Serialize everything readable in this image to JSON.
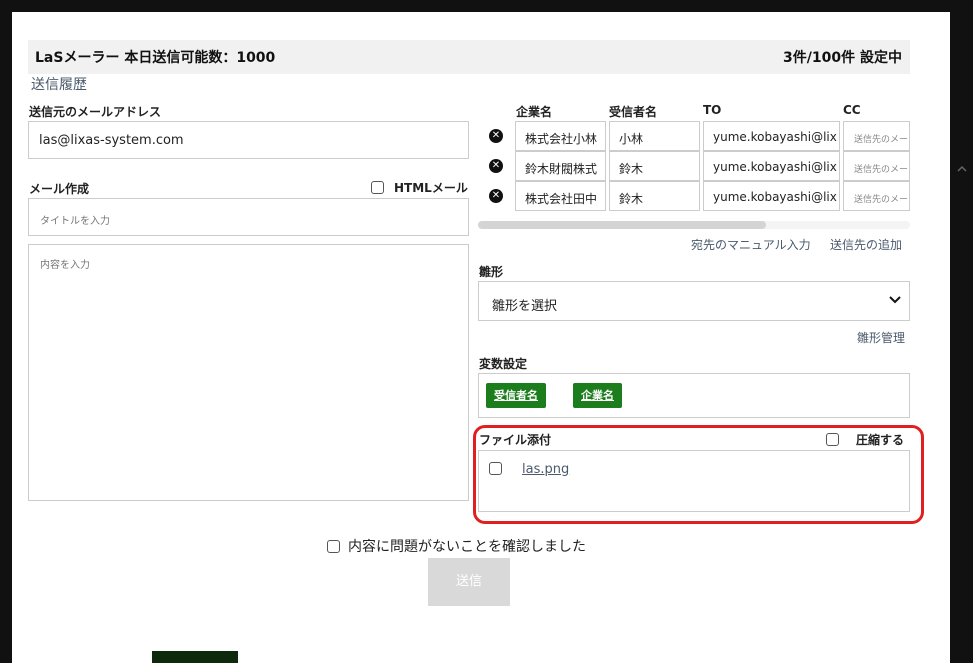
{
  "header": {
    "app_title": "LaSメーラー  本日送信可能数：1000",
    "count_status": "3件/100件 設定中"
  },
  "history_link": "送信履歴",
  "sender": {
    "label": "送信元のメールアドレス",
    "value": "las@lixas-system.com"
  },
  "compose": {
    "label": "メール作成",
    "html_mail_label": "HTMLメール",
    "title_placeholder": "タイトルを入力",
    "content_placeholder": "内容を入力"
  },
  "recipients": {
    "columns": [
      "企業名",
      "受信者名",
      "TO",
      "CC"
    ],
    "rows": [
      {
        "company": "株式会社小林",
        "name": "小林",
        "to": "yume.kobayashi@lix",
        "cc": "送信先のメー"
      },
      {
        "company": "鈴木財閥株式",
        "name": "鈴木",
        "to": "yume.kobayashi@lix",
        "cc": "送信先のメー"
      },
      {
        "company": "株式会社田中",
        "name": "鈴木",
        "to": "yume.kobayashi@lix",
        "cc": "送信先のメー"
      }
    ],
    "manual_input_link": "宛先のマニュアル入力",
    "add_recipient_link": "送信先の追加"
  },
  "template": {
    "label": "雛形",
    "selected": "雛形を選択",
    "manage_link": "雛形管理"
  },
  "variables": {
    "label": "変数設定",
    "items": [
      "受信者名",
      "企業名"
    ]
  },
  "attachment": {
    "label": "ファイル添付",
    "compress_label": "圧縮する",
    "files": [
      "las.png"
    ]
  },
  "confirm_label": "内容に問題がないことを確認しました",
  "send_label": "送信",
  "colors": {
    "accent_green": "#1b7d1b",
    "highlight_red": "#e02020",
    "link": "#4a5a6d"
  }
}
